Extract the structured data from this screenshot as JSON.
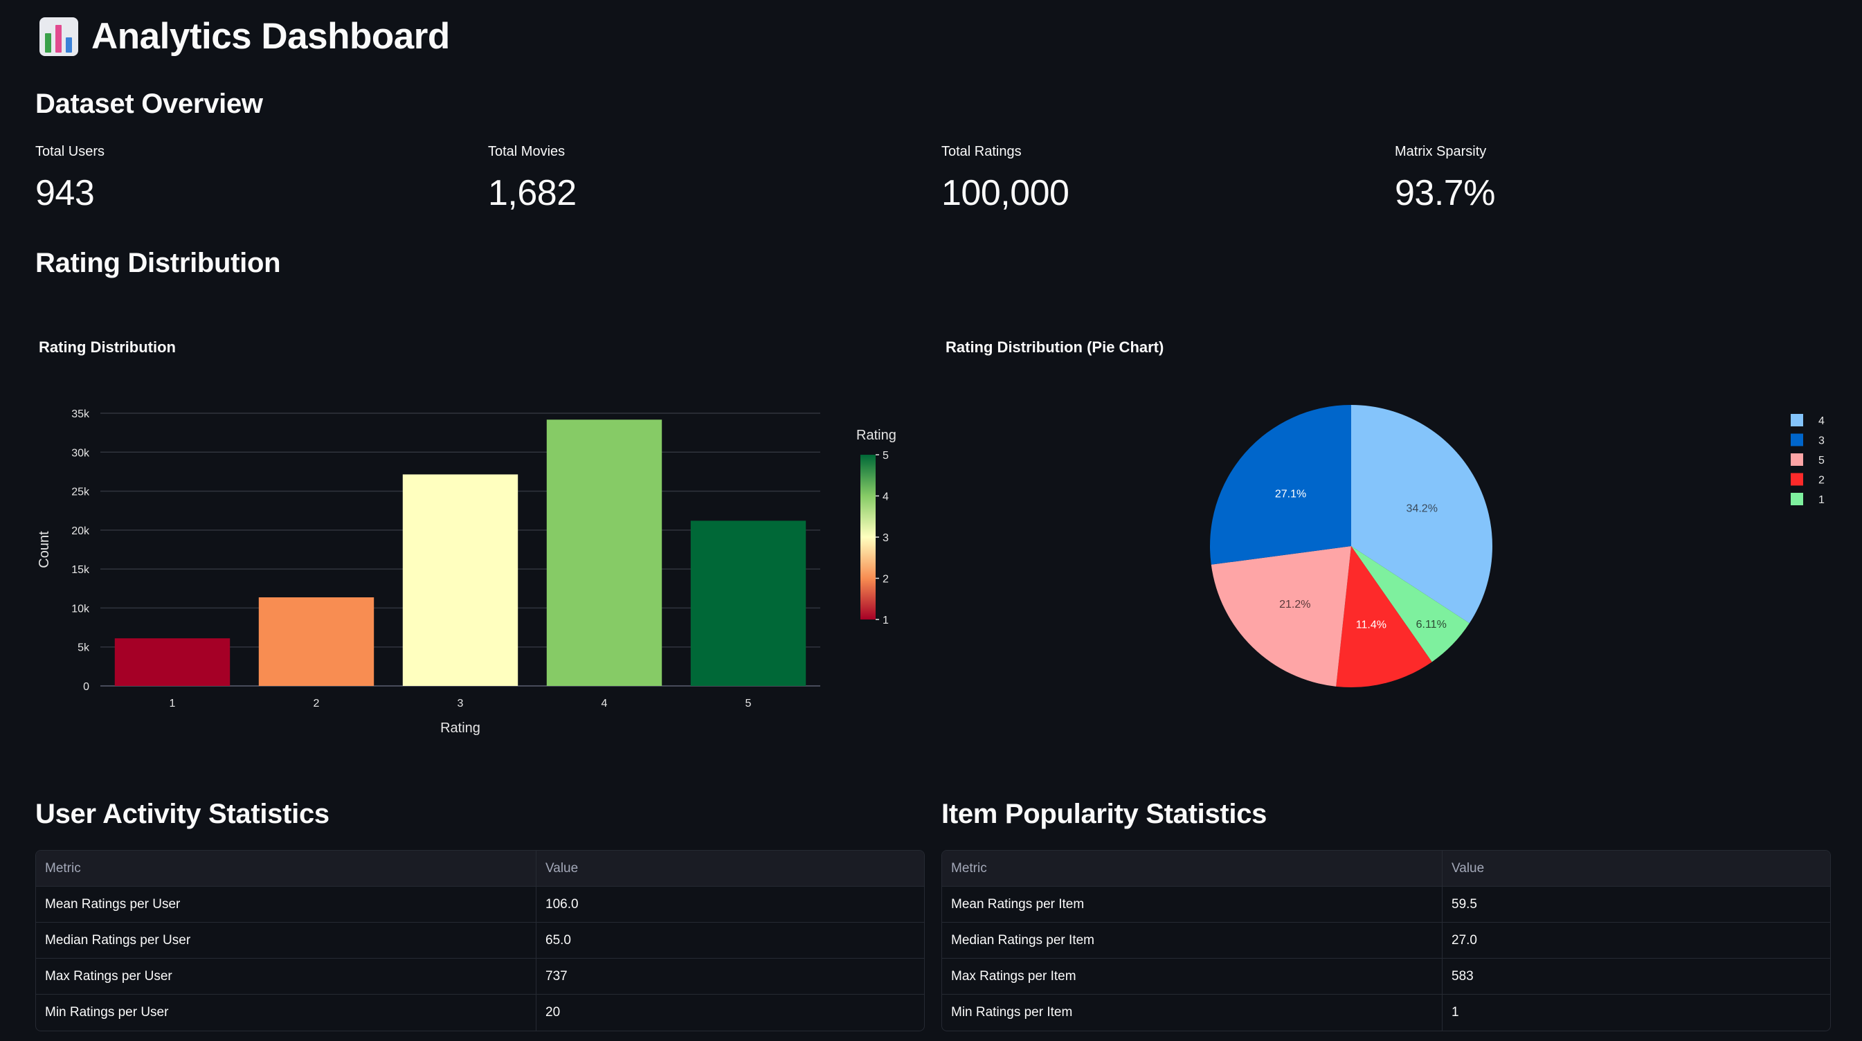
{
  "page": {
    "title": "Analytics Dashboard"
  },
  "overview": {
    "heading": "Dataset Overview",
    "metrics": [
      {
        "label": "Total Users",
        "value": "943"
      },
      {
        "label": "Total Movies",
        "value": "1,682"
      },
      {
        "label": "Total Ratings",
        "value": "100,000"
      },
      {
        "label": "Matrix Sparsity",
        "value": "93.7%"
      }
    ]
  },
  "rating_section": {
    "heading": "Rating Distribution"
  },
  "chart_data": [
    {
      "type": "bar",
      "title": "Rating Distribution",
      "categories": [
        "1",
        "2",
        "3",
        "4",
        "5"
      ],
      "values": [
        6110,
        11370,
        27145,
        34174,
        21201
      ],
      "colors": [
        "#a50026",
        "#f88d52",
        "#ffffbf",
        "#86cb66",
        "#006837"
      ],
      "xlabel": "Rating",
      "ylabel": "Count",
      "ylim": [
        0,
        35000
      ],
      "yticks": [
        0,
        5000,
        10000,
        15000,
        20000,
        25000,
        30000,
        35000
      ],
      "ytick_labels": [
        "0",
        "5k",
        "10k",
        "15k",
        "20k",
        "25k",
        "30k",
        "35k"
      ],
      "grid": true,
      "colorbar": {
        "title": "Rating",
        "ticks": [
          "1",
          "2",
          "3",
          "4",
          "5"
        ],
        "colors": [
          "#a50026",
          "#f88d52",
          "#ffffbf",
          "#86cb66",
          "#006837"
        ]
      }
    },
    {
      "type": "pie",
      "title": "Rating Distribution (Pie Chart)",
      "slices": [
        {
          "label": "4",
          "value": 34.2,
          "text": "34.2%",
          "color": "#84c4fb",
          "text_color": "#3a4a5a"
        },
        {
          "label": "1",
          "value": 6.11,
          "text": "6.11%",
          "color": "#7ef09e",
          "text_color": "#2d4a34"
        },
        {
          "label": "2",
          "value": 11.4,
          "text": "11.4%",
          "color": "#fd2a2a",
          "text_color": "#ffffff"
        },
        {
          "label": "5",
          "value": 21.2,
          "text": "21.2%",
          "color": "#fea5a6",
          "text_color": "#5a3a3a"
        },
        {
          "label": "3",
          "value": 27.1,
          "text": "27.1%",
          "color": "#0066cb",
          "text_color": "#ffffff"
        }
      ],
      "legend": {
        "placement": "right",
        "order": [
          "4",
          "3",
          "5",
          "2",
          "1"
        ]
      }
    }
  ],
  "user_activity": {
    "heading": "User Activity Statistics",
    "columns": [
      "Metric",
      "Value"
    ],
    "rows": [
      [
        "Mean Ratings per User",
        "106.0"
      ],
      [
        "Median Ratings per User",
        "65.0"
      ],
      [
        "Max Ratings per User",
        "737"
      ],
      [
        "Min Ratings per User",
        "20"
      ]
    ]
  },
  "item_popularity": {
    "heading": "Item Popularity Statistics",
    "columns": [
      "Metric",
      "Value"
    ],
    "rows": [
      [
        "Mean Ratings per Item",
        "59.5"
      ],
      [
        "Median Ratings per Item",
        "27.0"
      ],
      [
        "Max Ratings per Item",
        "583"
      ],
      [
        "Min Ratings per Item",
        "1"
      ]
    ]
  }
}
